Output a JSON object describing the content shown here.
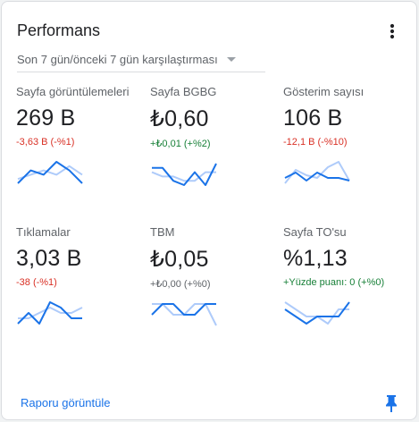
{
  "card": {
    "title": "Performans",
    "comparison": "Son 7 gün/önceki 7 gün karşılaştırması",
    "footer_link": "Raporu görüntüle"
  },
  "icons": {
    "menu": "more-vert-icon",
    "dropdown": "dropdown-arrow-icon",
    "pin": "pin-icon"
  },
  "colors": {
    "current_line": "#1a73e8",
    "previous_line": "#aecbfa",
    "negative": "#d93025",
    "positive": "#188038",
    "link": "#1a73e8"
  },
  "metrics": [
    {
      "label": "Sayfa görüntülemeleri",
      "value": "269 B",
      "delta": "-3,63 B (-%1)",
      "trend": "neg",
      "current": [
        3,
        6,
        5,
        8,
        6,
        3
      ],
      "previous": [
        4,
        5,
        6,
        5,
        7,
        5
      ]
    },
    {
      "label": "Sayfa BGBG",
      "value": "₺0,60",
      "delta": "+₺0,01 (+%2)",
      "trend": "pos",
      "current": [
        6,
        6,
        3,
        2,
        5,
        2,
        7
      ],
      "previous": [
        5,
        4,
        4,
        3,
        3,
        5,
        5
      ]
    },
    {
      "label": "Gösterim sayısı",
      "value": "106 B",
      "delta": "-12,1 B (-%10)",
      "trend": "neg",
      "current": [
        3,
        5,
        2,
        5,
        3,
        3,
        2
      ],
      "previous": [
        1,
        6,
        4,
        3,
        7,
        9,
        2
      ]
    },
    {
      "label": "Tıklamalar",
      "value": "3,03 B",
      "delta": "-38 (-%1)",
      "trend": "neg",
      "current": [
        2,
        4,
        2,
        6,
        5,
        3,
        3
      ],
      "previous": [
        3,
        3,
        4,
        5,
        4,
        4,
        5
      ]
    },
    {
      "label": "TBM",
      "value": "₺0,05",
      "delta": "+₺0,00 (+%0)",
      "trend": "neu",
      "current": [
        2,
        4,
        4,
        2,
        2,
        4,
        4
      ],
      "previous": [
        4,
        4,
        2,
        2,
        4,
        4,
        0
      ]
    },
    {
      "label": "Sayfa TO'su",
      "value": "%1,13",
      "delta": "+Yüzde puanı: 0 (+%0)",
      "trend": "pos",
      "current": [
        4,
        3,
        2,
        3,
        3,
        3,
        5
      ],
      "previous": [
        5,
        4,
        3,
        3,
        2,
        4,
        4
      ]
    }
  ]
}
